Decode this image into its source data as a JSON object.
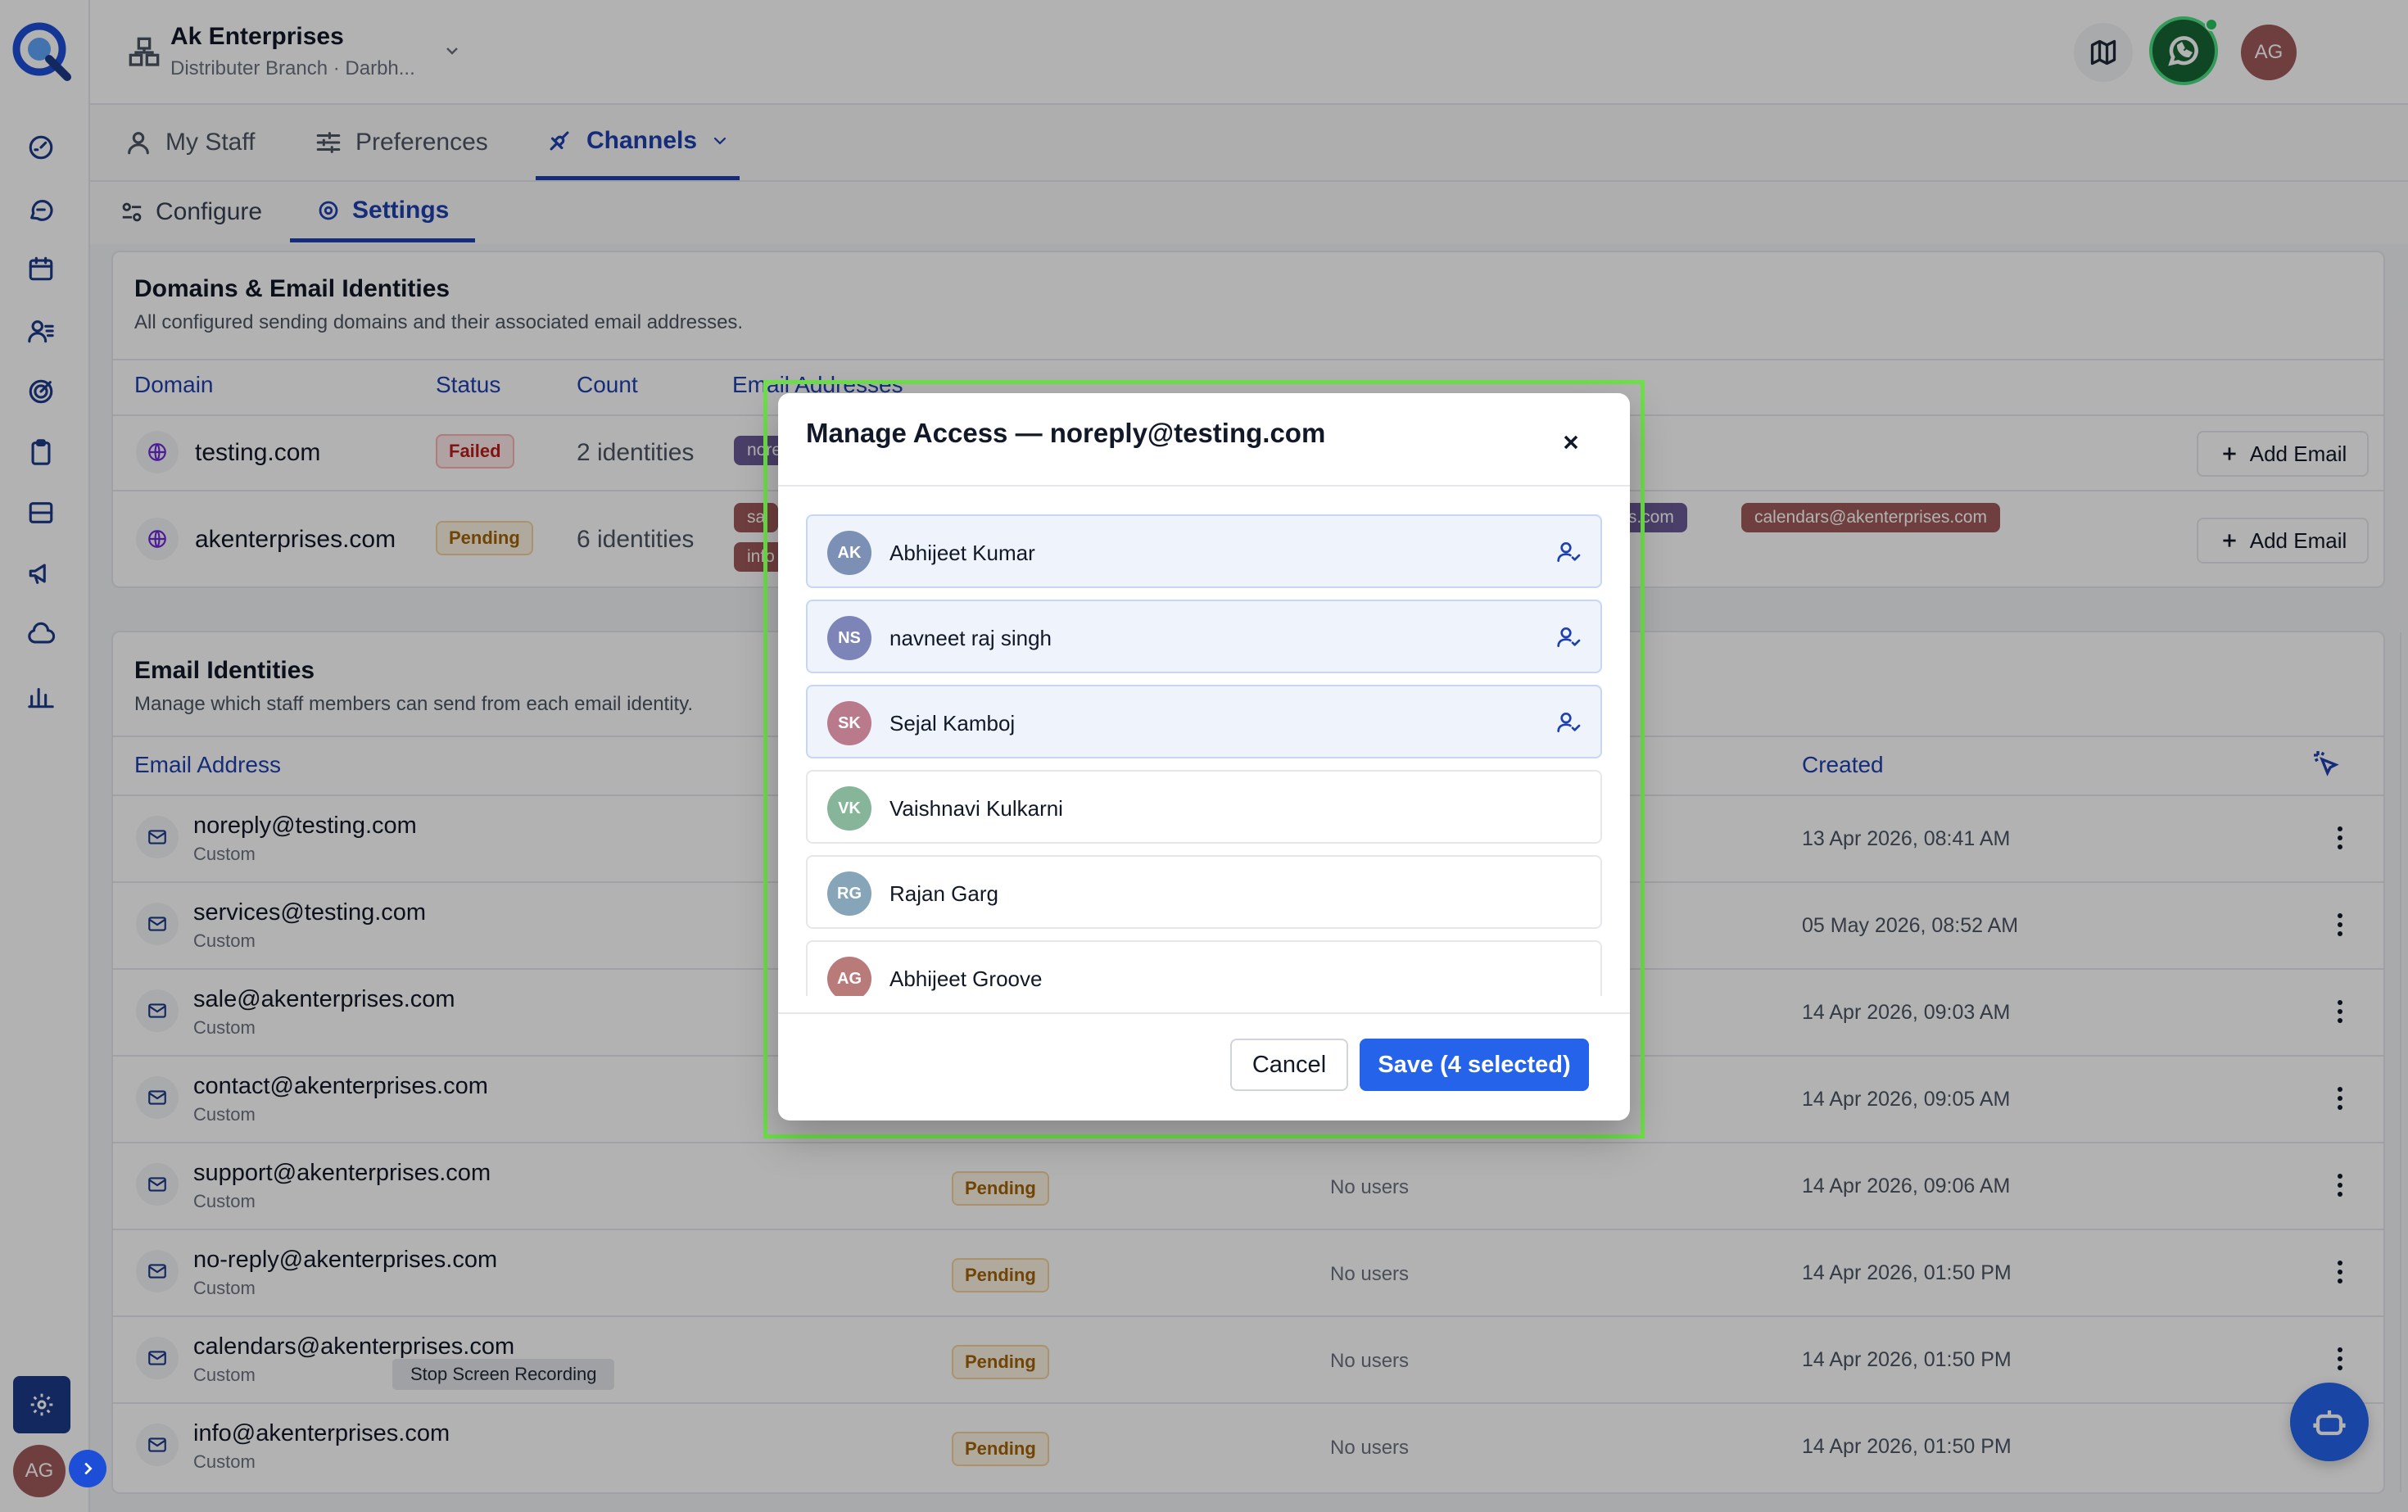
{
  "colors": {
    "primary": "#1e40af",
    "accent_button": "#2563eb",
    "failed": "#b91c1c",
    "pending": "#a16207",
    "whatsapp": "#166534",
    "highlight": "#6ee04a"
  },
  "header": {
    "org_name": "Ak Enterprises",
    "org_sub": "Distributer Branch · Darbh...",
    "avatar": "AG",
    "icons": [
      "map-icon",
      "bell-icon",
      "whatsapp-icon"
    ]
  },
  "sidebar": {
    "icons": [
      "dashboard-icon",
      "chat-icon",
      "calendar-icon",
      "users-icon",
      "target-icon",
      "clipboard-icon",
      "inbox-icon",
      "megaphone-icon",
      "cloud-icon",
      "bar-chart-icon"
    ],
    "avatar": "AG"
  },
  "tabs": {
    "my_staff": "My Staff",
    "preferences": "Preferences",
    "channels": "Channels"
  },
  "subtabs": {
    "configure": "Configure",
    "settings": "Settings"
  },
  "domains": {
    "title": "Domains & Email Identities",
    "description": "All configured sending domains and their associated email addresses.",
    "headers": {
      "domain": "Domain",
      "status": "Status",
      "count": "Count",
      "emails": "Email Addresses"
    },
    "rows": [
      {
        "domain": "testing.com",
        "status": "Failed",
        "count": "2 identities",
        "chips": [
          "nore"
        ],
        "action": "Add Email"
      },
      {
        "domain": "akenterprises.com",
        "status": "Pending",
        "count": "6 identities",
        "chips": [
          "sa",
          "info",
          "rises.com",
          "calendars@akenterprises.com"
        ],
        "action": "Add Email"
      }
    ]
  },
  "identities": {
    "title": "Email Identities",
    "description": "Manage which staff members can send from each email identity.",
    "headers": {
      "email": "Email Address",
      "created": "Created"
    },
    "rows": [
      {
        "email": "noreply@testing.com",
        "type": "Custom",
        "status": "",
        "users": "",
        "created": "13 Apr 2026, 08:41 AM"
      },
      {
        "email": "services@testing.com",
        "type": "Custom",
        "status": "",
        "users": "",
        "created": "05 May 2026, 08:52 AM"
      },
      {
        "email": "sale@akenterprises.com",
        "type": "Custom",
        "status": "",
        "users": "",
        "created": "14 Apr 2026, 09:03 AM"
      },
      {
        "email": "contact@akenterprises.com",
        "type": "Custom",
        "status": "",
        "users": "",
        "created": "14 Apr 2026, 09:05 AM"
      },
      {
        "email": "support@akenterprises.com",
        "type": "Custom",
        "status": "Pending",
        "users": "No users",
        "created": "14 Apr 2026, 09:06 AM"
      },
      {
        "email": "no-reply@akenterprises.com",
        "type": "Custom",
        "status": "Pending",
        "users": "No users",
        "created": "14 Apr 2026, 01:50 PM"
      },
      {
        "email": "calendars@akenterprises.com",
        "type": "Custom",
        "status": "Pending",
        "users": "No users",
        "created": "14 Apr 2026, 01:50 PM"
      },
      {
        "email": "info@akenterprises.com",
        "type": "Custom",
        "status": "Pending",
        "users": "No users",
        "created": "14 Apr 2026, 01:50 PM"
      }
    ]
  },
  "tooltip": "Stop Screen Recording",
  "modal": {
    "title": "Manage Access — noreply@testing.com",
    "users": [
      {
        "initials": "AK",
        "name": "Abhijeet Kumar",
        "selected": true,
        "color": "#7c8fb5"
      },
      {
        "initials": "NS",
        "name": "navneet raj singh",
        "selected": true,
        "color": "#7d84b8"
      },
      {
        "initials": "SK",
        "name": "Sejal Kamboj",
        "selected": true,
        "color": "#b97a8c"
      },
      {
        "initials": "VK",
        "name": "Vaishnavi Kulkarni",
        "selected": false,
        "color": "#86b59a"
      },
      {
        "initials": "RG",
        "name": "Rajan Garg",
        "selected": false,
        "color": "#86a5b8"
      },
      {
        "initials": "AG",
        "name": "Abhijeet Groove",
        "selected": false,
        "color": "#b97a7a"
      }
    ],
    "cancel": "Cancel",
    "save": "Save (4 selected)"
  }
}
